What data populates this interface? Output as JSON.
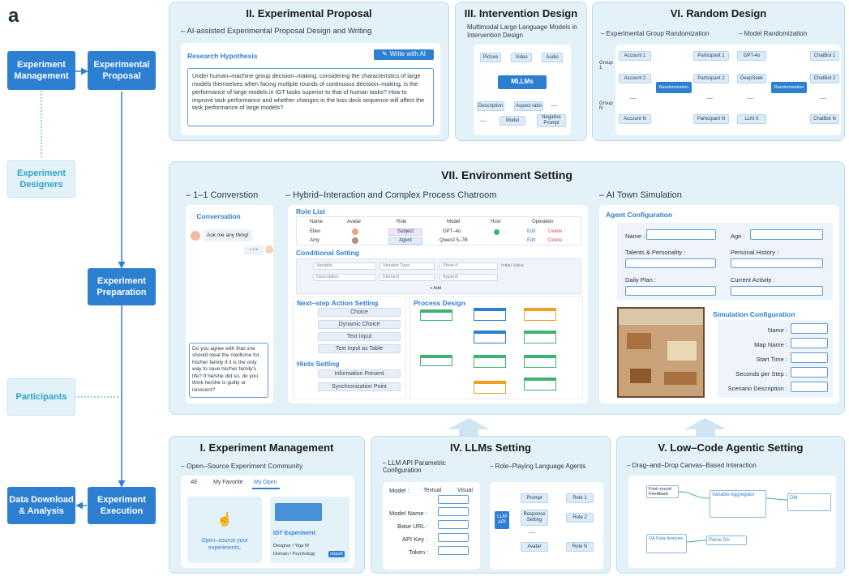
{
  "figure_label": "a",
  "flow": {
    "exp_mgmt": "Experiment Management",
    "exp_proposal": "Experimental Proposal",
    "designers": "Experiment Designers",
    "preparation": "Experiment Preparation",
    "participants": "Participants",
    "execution": "Experiment Execution",
    "download": "Data Download & Analysis"
  },
  "p2": {
    "title": "II. Experimental Proposal",
    "subtitle": "– AI-assisted Experimental Proposal Design and Writing",
    "rh_label": "Research Hypothesis",
    "write_ai": "Write with AI",
    "hypothesis": "Under human–machine group decision–making, considering the characteristics of large models themselves when facing multiple rounds of continuous decision–making, is the performance of large models in IGT tasks superior to that of human tasks? How to improve task performance and whether changes in the loss deck sequence will affect the task performance of large models?"
  },
  "p3": {
    "title": "III. Intervention Design",
    "subtitle": "Multimodal Large Language Models in Intervention Design",
    "picture": "Picture",
    "video": "Video",
    "audio": "Audio",
    "mllms": "MLLMs",
    "description": "Description",
    "aspect_ratio": "Aspect ratio",
    "dots1": "----",
    "dots2": "----",
    "model": "Model",
    "neg_prompt": "Negative Prompt"
  },
  "p6": {
    "title": "VI. Random Design",
    "sub1": "– Experimental Group Randomization",
    "sub2": "– Model Randomization",
    "group1": "Group 1",
    "groupN": "Group N",
    "acc1": "Account 1",
    "acc2": "Account 2",
    "accdots": "----",
    "accN": "Account N",
    "rand1": "Randomization",
    "part1": "Participant 1",
    "part2": "Participant 2",
    "partdots": "----",
    "partN": "Participant N",
    "gpt": "GPT-4o",
    "deepseek": "DeepSeek",
    "mdots": "----",
    "llmx": "LLM X",
    "rand2": "Randomization",
    "cb1": "ChatBot 1",
    "cb2": "ChatBot 2",
    "cbdots": "----",
    "cbN": "ChatBot N"
  },
  "p7": {
    "title": "VII. Environment Setting",
    "conv_title": "– 1–1 Converstion",
    "hybrid_title": "– Hybrid–Interaction and Complex Process Chatroom",
    "town_title": "– AI Town Simulation",
    "conversation": "Conversation",
    "ask": "Ask me any thing!",
    "dots": "• • •",
    "question": "Do you agree with that one should steal the medicine for his/her family if it is the only way to save his/her family's life? If he/she did so, do you think he/she is guilty or innocent?",
    "role_list": "Role List",
    "cols": [
      "Name",
      "Avatar",
      "Role",
      "Model",
      "Host",
      "Operation"
    ],
    "rows": [
      {
        "name": "Ellen",
        "role": "Subject",
        "model": "GPT–4o",
        "edit": "Edit",
        "del": "Delete"
      },
      {
        "name": "Amy",
        "role": "Agent",
        "model": "Qwen2.5–7B",
        "edit": "Edit",
        "del": "Delete"
      }
    ],
    "cond": "Conditional Setting",
    "variable": "Variable",
    "var_type": "Variable Type",
    "show_if": "Show if",
    "initial": "Initial Value",
    "description": "Description",
    "element": "Element",
    "append": "Append",
    "add": "+ Add",
    "next_step": "Next–step Action Setting",
    "choice": "Choice",
    "dyn_choice": "Dynamic Choice",
    "text_input": "Text Input",
    "text_table": "Text Input as Table",
    "hints": "Hints Setting",
    "info_present": "Information Present",
    "sync_point": "Synchronization Point",
    "process": "Process Design",
    "agent_conf": "Agent Configuration",
    "name": "Name :",
    "age": "Age :",
    "talents": "Talents & Personality :",
    "history": "Personal History :",
    "daily": "Daily Plan :",
    "activity": "Current Activity :",
    "sim_conf": "Simulation Configuration",
    "s_name": "Name :",
    "map": "Map Name :",
    "start": "Start Time :",
    "secs": "Seconds per Step :",
    "scenario": "Scenario Description :"
  },
  "p1": {
    "title": "I. Experiment Management",
    "subtitle": "– Open–Source Experiment Community",
    "tab_all": "All",
    "tab_fav": "My Favorite",
    "tab_open": "My Open",
    "open_src": "Open–source your experiments.",
    "igt": "IGT Experiment",
    "designer": "Designer / Yiga W",
    "domain": "Domain / Psychology",
    "import": "Import"
  },
  "p4": {
    "title": "IV. LLMs Setting",
    "sub1": "– LLM API Parametric Configuration",
    "sub2": "– Role–Playing Language Agents",
    "model": "Model :",
    "textual": "Textual",
    "visual": "Visual",
    "model_name": "Model Name :",
    "base_url": "Base URL :",
    "api_key": "API Key :",
    "token": "Token :",
    "llm_api": "LLM API",
    "prompt": "Prompt",
    "resp": "Response Setting",
    "dots": "----",
    "avatar": "Avatar",
    "role1": "Role 1",
    "role2": "Role 2",
    "roleN": "Role N"
  },
  "p5": {
    "title": "V. Low–Code Agentic Setting",
    "subtitle": "– Drag–and–Drop Canvas–Based Interaction",
    "first": "First–round Feedback",
    "aggr": "Variable Aggregator",
    "dm": "DM",
    "da": "DA Data Analysis",
    "parse": "Parse DA"
  }
}
